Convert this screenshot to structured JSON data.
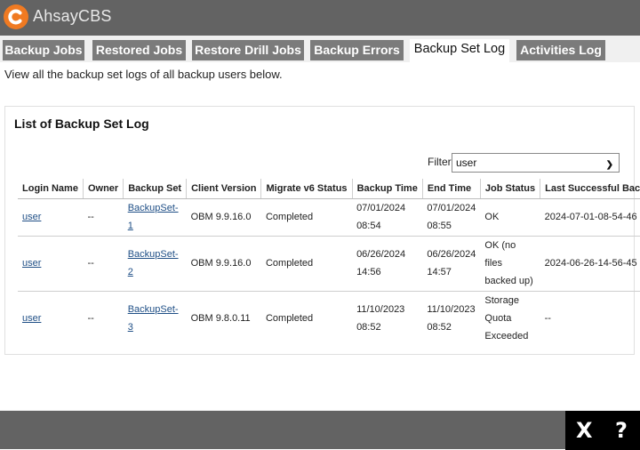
{
  "app": {
    "title": "AhsayCBS",
    "logo_color": "#f07a22"
  },
  "tabs": [
    {
      "label": "Backup Jobs",
      "active": false
    },
    {
      "label": "Restored Jobs",
      "active": false
    },
    {
      "label": "Restore Drill Jobs",
      "active": false
    },
    {
      "label": "Backup Errors",
      "active": false
    },
    {
      "label": "Backup Set Log",
      "active": true
    },
    {
      "label": "Activities Log",
      "active": false
    }
  ],
  "description": "View all the backup set logs of all backup users below.",
  "panel": {
    "title": "List of Backup Set Log",
    "filter_label": "Filter",
    "filter_value": "user"
  },
  "table": {
    "columns": [
      "Login Name",
      "Owner",
      "Backup Set",
      "Client Version",
      "Migrate v6 Status",
      "Backup Time",
      "End Time",
      "Job Status",
      "Last Successful Backup"
    ],
    "rows": [
      {
        "login_name": "user",
        "owner": "--",
        "backup_set_line1": "BackupSet-",
        "backup_set_line2": "1",
        "client_version": "OBM 9.9.16.0",
        "migrate_status": "Completed",
        "backup_date": "07/01/2024",
        "backup_time": "08:54",
        "end_date": "07/01/2024",
        "end_time": "08:55",
        "job_status": [
          "OK"
        ],
        "last_successful": "2024-07-01-08-54-46"
      },
      {
        "login_name": "user",
        "owner": "--",
        "backup_set_line1": "BackupSet-",
        "backup_set_line2": "2",
        "client_version": "OBM 9.9.16.0",
        "migrate_status": "Completed",
        "backup_date": "06/26/2024",
        "backup_time": "14:56",
        "end_date": "06/26/2024",
        "end_time": "14:57",
        "job_status": [
          "OK (no",
          "files",
          "backed up)"
        ],
        "last_successful": "2024-06-26-14-56-45"
      },
      {
        "login_name": "user",
        "owner": "--",
        "backup_set_line1": "BackupSet-",
        "backup_set_line2": "3",
        "client_version": "OBM 9.8.0.11",
        "migrate_status": "Completed",
        "backup_date": "11/10/2023",
        "backup_time": "08:52",
        "end_date": "11/10/2023",
        "end_time": "08:52",
        "job_status": [
          "Storage",
          "Quota",
          "Exceeded"
        ],
        "last_successful": "--"
      }
    ]
  },
  "footer": {
    "close_label": "X",
    "help_label": "?"
  }
}
